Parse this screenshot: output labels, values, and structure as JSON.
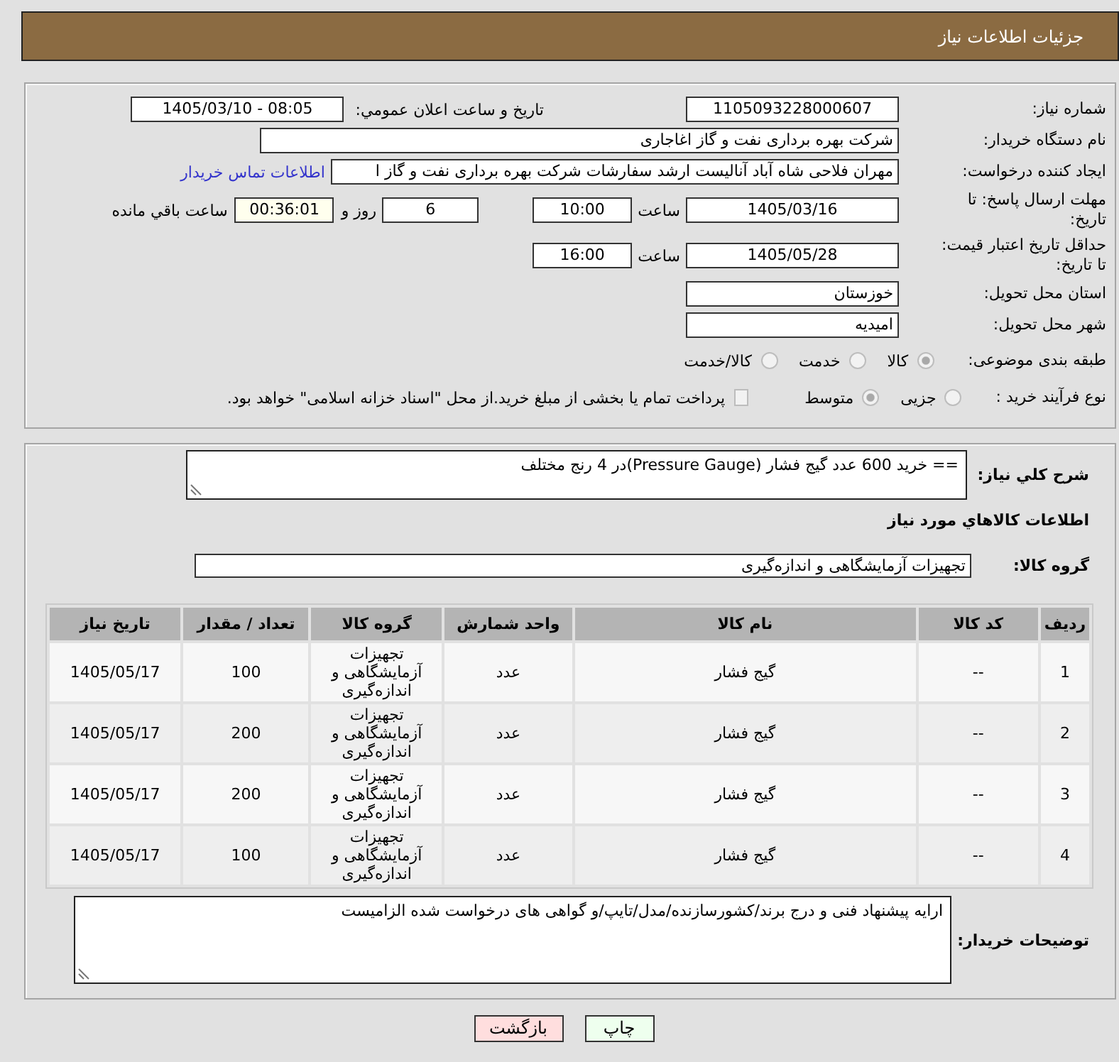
{
  "header": {
    "title": "جزئیات اطلاعات نیاز"
  },
  "details": {
    "need_number": {
      "label": "شماره نیاز:",
      "value": "1105093228000607"
    },
    "announcement": {
      "label": "تاریخ و ساعت اعلان عمومي:",
      "value": "1405/03/10 - 08:05"
    },
    "buyer_org": {
      "label": "نام دستگاه خریدار:",
      "value": "شرکت بهره برداری نفت و گاز اغاجاری"
    },
    "requester": {
      "label": "ایجاد کننده درخواست:",
      "value": "مهران فلاحی شاه آباد آنالیست ارشد سفارشات شرکت بهره برداری نفت و گاز ا",
      "contact_link": "اطلاعات تماس خریدار"
    },
    "response_deadline": {
      "label": "مهلت ارسال پاسخ: تا تاریخ:",
      "date": "1405/03/16",
      "time_label": "ساعت",
      "time": "10:00",
      "days": "6",
      "days_label": "روز و",
      "remaining": "00:36:01",
      "remaining_label": "ساعت باقي مانده"
    },
    "price_validity": {
      "label": "حداقل تاریخ اعتبار قیمت: تا تاریخ:",
      "date": "1405/05/28",
      "time_label": "ساعت",
      "time": "16:00"
    },
    "delivery_province": {
      "label": "استان محل تحویل:",
      "value": "خوزستان"
    },
    "delivery_city": {
      "label": "شهر محل تحویل:",
      "value": "امیدیه"
    },
    "subject_category": {
      "label": "طبقه بندی موضوعی:",
      "options": [
        {
          "label": "کالا",
          "selected": true
        },
        {
          "label": "خدمت",
          "selected": false
        },
        {
          "label": "کالا/خدمت",
          "selected": false
        }
      ]
    },
    "purchase_process": {
      "label": "نوع فرآیند خرید :",
      "options": [
        {
          "label": "جزیی",
          "selected": false
        },
        {
          "label": "متوسط",
          "selected": true
        }
      ],
      "treasury_payment": {
        "label": "پرداخت تمام یا بخشی از مبلغ خرید.از محل \"اسناد خزانه اسلامی\" خواهد بود.",
        "checked": false
      }
    }
  },
  "description": {
    "label": "شرح کلي نیاز:",
    "value": "== خرید 600 عدد گیج فشار (Pressure Gauge)در 4 رنج مختلف"
  },
  "items": {
    "title": "اطلاعات کالاهاي مورد نیاز",
    "group_label": "گروه کالا:",
    "group_value": "تجهیزات آزمایشگاهی و اندازه‌گیری"
  },
  "table": {
    "columns": [
      "ردیف",
      "کد کالا",
      "نام کالا",
      "واحد شمارش",
      "گروه کالا",
      "تعداد / مقدار",
      "تاریخ نیاز"
    ],
    "rows": [
      [
        "1",
        "--",
        "گیج فشار",
        "عدد",
        "تجهیزات آزمایشگاهی و اندازه‌گیری",
        "100",
        "1405/05/17"
      ],
      [
        "2",
        "--",
        "گیج فشار",
        "عدد",
        "تجهیزات آزمایشگاهی و اندازه‌گیری",
        "200",
        "1405/05/17"
      ],
      [
        "3",
        "--",
        "گیج فشار",
        "عدد",
        "تجهیزات آزمایشگاهی و اندازه‌گیری",
        "200",
        "1405/05/17"
      ],
      [
        "4",
        "--",
        "گیج فشار",
        "عدد",
        "تجهیزات آزمایشگاهی و اندازه‌گیری",
        "100",
        "1405/05/17"
      ]
    ]
  },
  "buyer_notes": {
    "label": "توضیحات خریدار:",
    "value": "ارایه پیشنهاد فنی و درج برند/کشورسازنده/مدل/تایپ/و گواهی های درخواست شده الزامیست"
  },
  "buttons": [
    {
      "label": "چاپ",
      "kind": "print"
    },
    {
      "label": "بازگشت",
      "kind": "back"
    }
  ]
}
